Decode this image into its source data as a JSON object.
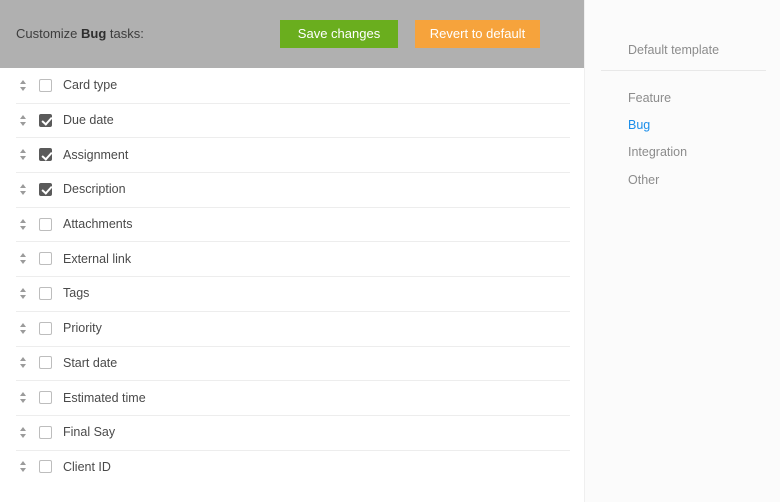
{
  "toolbar": {
    "title_prefix": "Customize ",
    "title_entity": "Bug",
    "title_suffix": " tasks:",
    "save_label": "Save changes",
    "revert_label": "Revert to default",
    "save_color": "#6aae1e",
    "revert_color": "#f6a33c",
    "background_color": "#b0b0b0"
  },
  "fields": [
    {
      "label": "Card type",
      "checked": false
    },
    {
      "label": "Due date",
      "checked": true
    },
    {
      "label": "Assignment",
      "checked": true
    },
    {
      "label": "Description",
      "checked": true
    },
    {
      "label": "Attachments",
      "checked": false
    },
    {
      "label": "External link",
      "checked": false
    },
    {
      "label": "Tags",
      "checked": false
    },
    {
      "label": "Priority",
      "checked": false
    },
    {
      "label": "Start date",
      "checked": false
    },
    {
      "label": "Estimated time",
      "checked": false
    },
    {
      "label": "Final Say",
      "checked": false
    },
    {
      "label": "Client ID",
      "checked": false
    }
  ],
  "sidebar": {
    "header": "Default template",
    "active_color": "#1b8eea",
    "items": [
      {
        "label": "Feature",
        "active": false
      },
      {
        "label": "Bug",
        "active": true
      },
      {
        "label": "Integration",
        "active": false
      },
      {
        "label": "Other",
        "active": false
      }
    ]
  }
}
